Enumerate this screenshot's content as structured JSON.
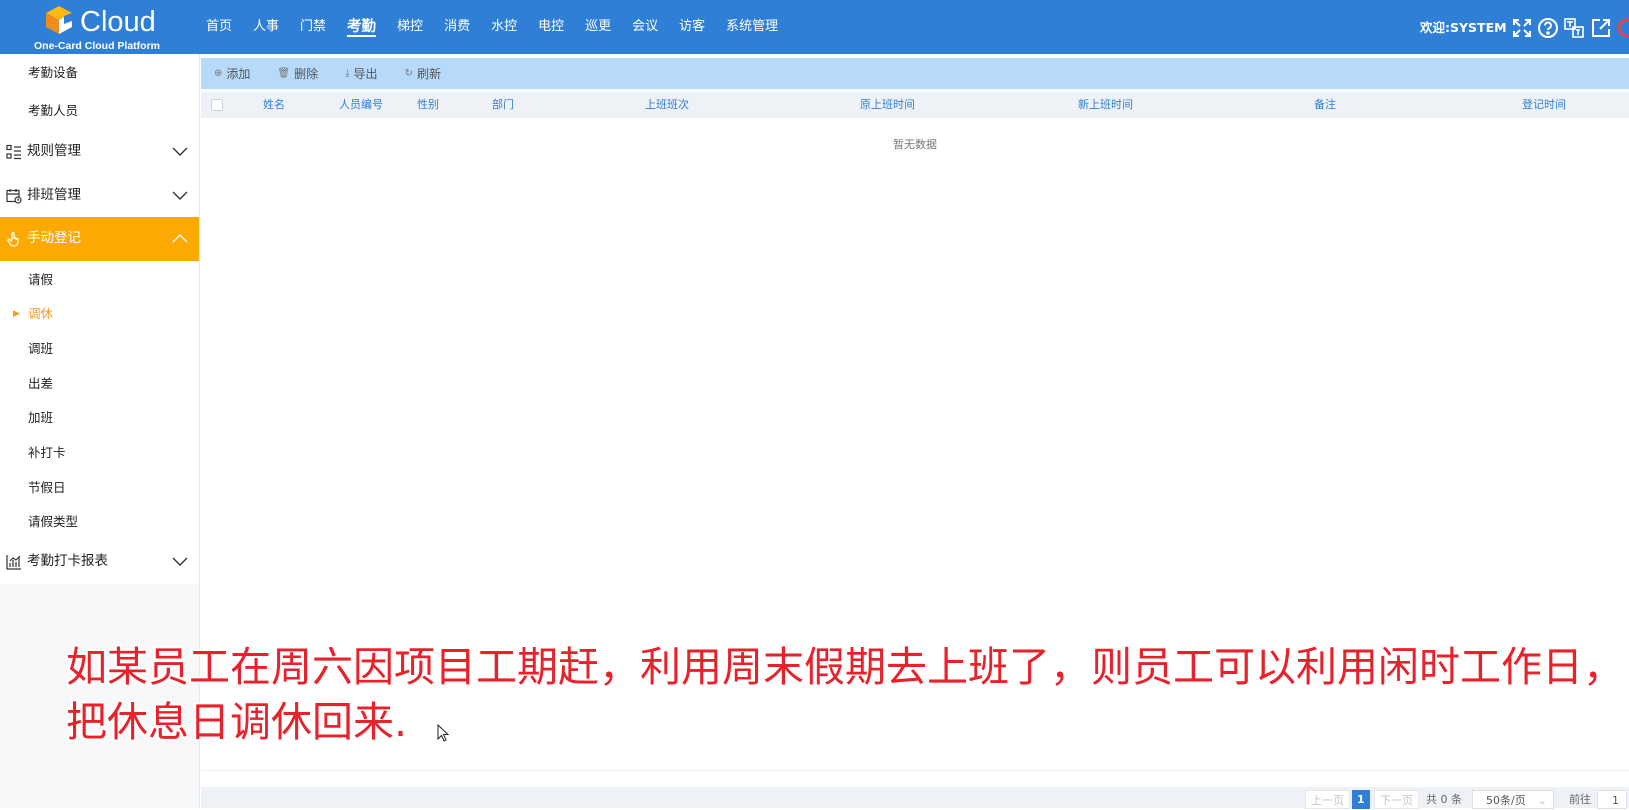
{
  "header": {
    "brand": "Cloud",
    "brand_sub": "One-Card Cloud Platform",
    "nav": [
      "首页",
      "人事",
      "门禁",
      "考勤",
      "梯控",
      "消费",
      "水控",
      "电控",
      "巡更",
      "会议",
      "访客",
      "系统管理"
    ],
    "active_nav": "考勤",
    "welcome": "欢迎:SYSTEM",
    "tools": [
      "fullscreen-icon",
      "help-icon",
      "language-icon",
      "external-link-icon",
      "power-icon"
    ],
    "colors": {
      "bar": "#2f7fd6"
    }
  },
  "sidebar": {
    "top_items": [
      "考勤设备",
      "考勤人员"
    ],
    "groups": [
      {
        "label": "规则管理",
        "icon": "list-icon",
        "expanded": false
      },
      {
        "label": "排班管理",
        "icon": "calendar-icon",
        "expanded": false
      },
      {
        "label": "手动登记",
        "icon": "hand-icon",
        "expanded": true
      },
      {
        "label": "考勤打卡报表",
        "icon": "chart-icon",
        "expanded": false
      }
    ],
    "manual_items": [
      "请假",
      "调休",
      "调班",
      "出差",
      "加班",
      "补打卡",
      "节假日",
      "请假类型"
    ],
    "selected": "调休",
    "colors": {
      "active_group": "#fda904",
      "selected_item": "#f59a23"
    }
  },
  "toolbar": {
    "add": "添加",
    "delete": "删除",
    "export": "导出",
    "refresh": "刷新"
  },
  "table": {
    "columns": [
      "姓名",
      "人员编号",
      "性别",
      "部门",
      "上班班次",
      "原上班时间",
      "新上班时间",
      "备注",
      "登记时间"
    ],
    "empty_text": "暂无数据"
  },
  "pagination": {
    "prev": "上一页",
    "current_page": "1",
    "next": "下一页",
    "total": "共 0 条",
    "page_size": "50条/页",
    "goto_label": "前往",
    "goto_value": "1"
  },
  "caption": {
    "line1": "如某员工在周六因项目工期赶，利用周末假期去上班了，则员工可以利用闲时工作日，",
    "line2": "把休息日调休回来."
  }
}
